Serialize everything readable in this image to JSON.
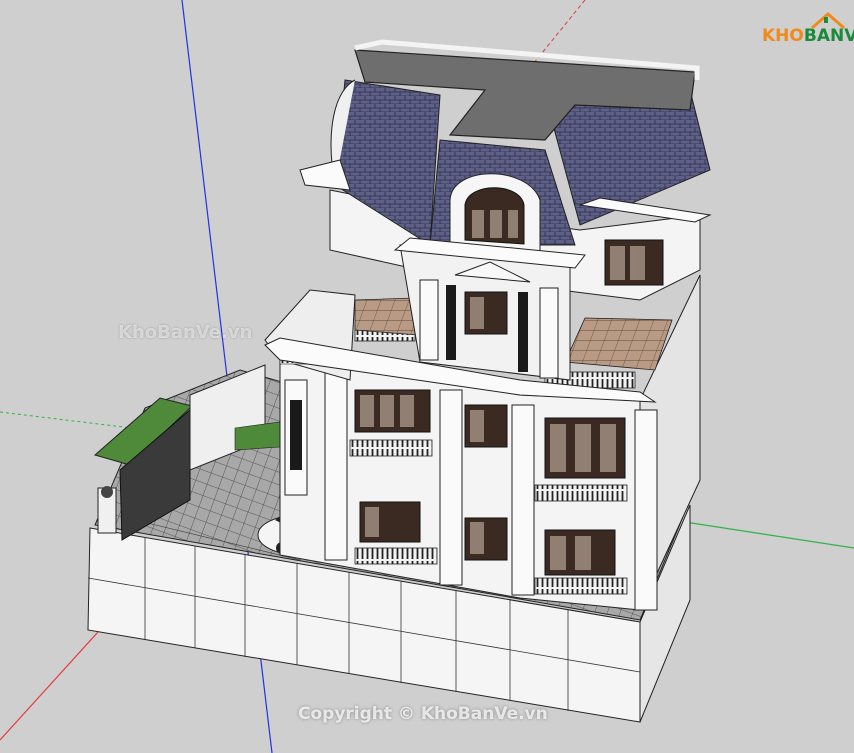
{
  "watermark_middle": "KhoBanVe.vn",
  "watermark_bottom": "Copyright © KhoBanVe.vn",
  "logo": {
    "text_part1": "KHO",
    "text_part2": "BANVE"
  },
  "colors": {
    "background": "#cfcfcf",
    "roof_slate": "#5d5f86",
    "roof_flat": "#6e6e6e",
    "wall": "#f4f4f4",
    "terrace_tile": "#b89a86",
    "grass": "#4f8a3a",
    "paving": "#9a9a9a",
    "axis_blue": "#2233dd",
    "axis_red": "#e23b3b",
    "axis_green": "#2fb34a"
  }
}
